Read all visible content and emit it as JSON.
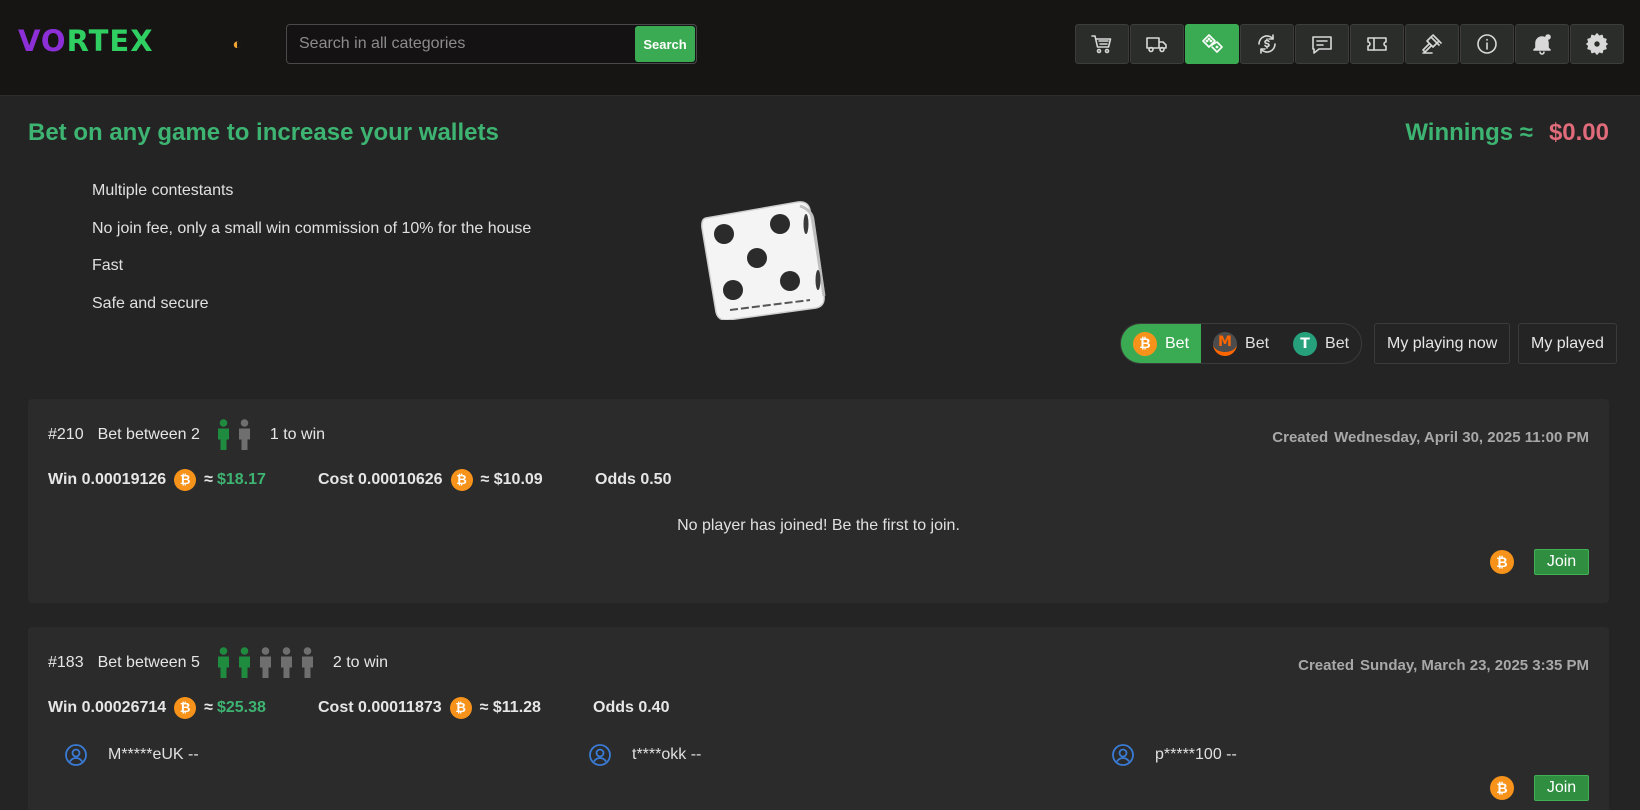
{
  "header": {
    "logo_mark": "VO",
    "logo_text": "RTEX",
    "theme_icon": "half-moon-icon",
    "search": {
      "placeholder": "Search in all categories",
      "value": "",
      "button_label": "Search"
    },
    "nav_icons": [
      "cart-icon",
      "truck-icon",
      "dice-icon",
      "exchange-icon",
      "chat-icon",
      "ticket-icon",
      "gavel-icon",
      "info-icon",
      "bell-icon",
      "gear-icon"
    ],
    "active_nav": "dice-icon"
  },
  "intro": {
    "title": "Bet on any game to increase your wallets",
    "winnings_label": "Winnings ≈",
    "winnings_value": "$0.00",
    "features": [
      "Multiple contestants",
      "No join fee, only a small win commission of 10% for the house",
      "Fast",
      "Safe and secure"
    ]
  },
  "filters": {
    "pills": [
      {
        "coin": "bitcoin",
        "symbol": "₿",
        "label": "Bet",
        "active": true
      },
      {
        "coin": "monero",
        "symbol": "M",
        "label": "Bet",
        "active": false
      },
      {
        "coin": "tether",
        "symbol": "T",
        "label": "Bet",
        "active": false
      }
    ],
    "my_playing_now": "My playing now",
    "my_played": "My played"
  },
  "bets": [
    {
      "id": "#210",
      "between_label": "Bet between 2",
      "total_players": 2,
      "joined_players": 1,
      "to_win": "1 to win",
      "created_label": "Created",
      "created_date": "Wednesday, April 30, 2025 11:00 PM",
      "win_label": "Win 0.00019126",
      "win_usd_prefix": "≈",
      "win_usd": "$18.17",
      "cost_label": "Cost 0.00010626",
      "cost_usd": "≈ $10.09",
      "odds": "Odds 0.50",
      "empty_message": "No player has joined! Be the first to join.",
      "players": [],
      "join_label": "Join"
    },
    {
      "id": "#183",
      "between_label": "Bet between 5",
      "total_players": 5,
      "joined_players": 2,
      "to_win": "2 to win",
      "created_label": "Created",
      "created_date": "Sunday, March 23, 2025 3:35 PM",
      "win_label": "Win 0.00026714",
      "win_usd_prefix": "≈",
      "win_usd": "$25.38",
      "cost_label": "Cost 0.00011873",
      "cost_usd": "≈ $11.28",
      "odds": "Odds 0.40",
      "empty_message": "",
      "players": [
        "M*****eUK --",
        "t****okk --",
        "p*****100 --"
      ],
      "join_label": "Join"
    }
  ],
  "colors": {
    "accent_green": "#3bab53",
    "title_green": "#3eb472",
    "winnings_red": "#e06b7a",
    "bitcoin_orange": "#f7931a",
    "player_joined": "#1f8b3f",
    "player_open": "#6f6f6f"
  }
}
